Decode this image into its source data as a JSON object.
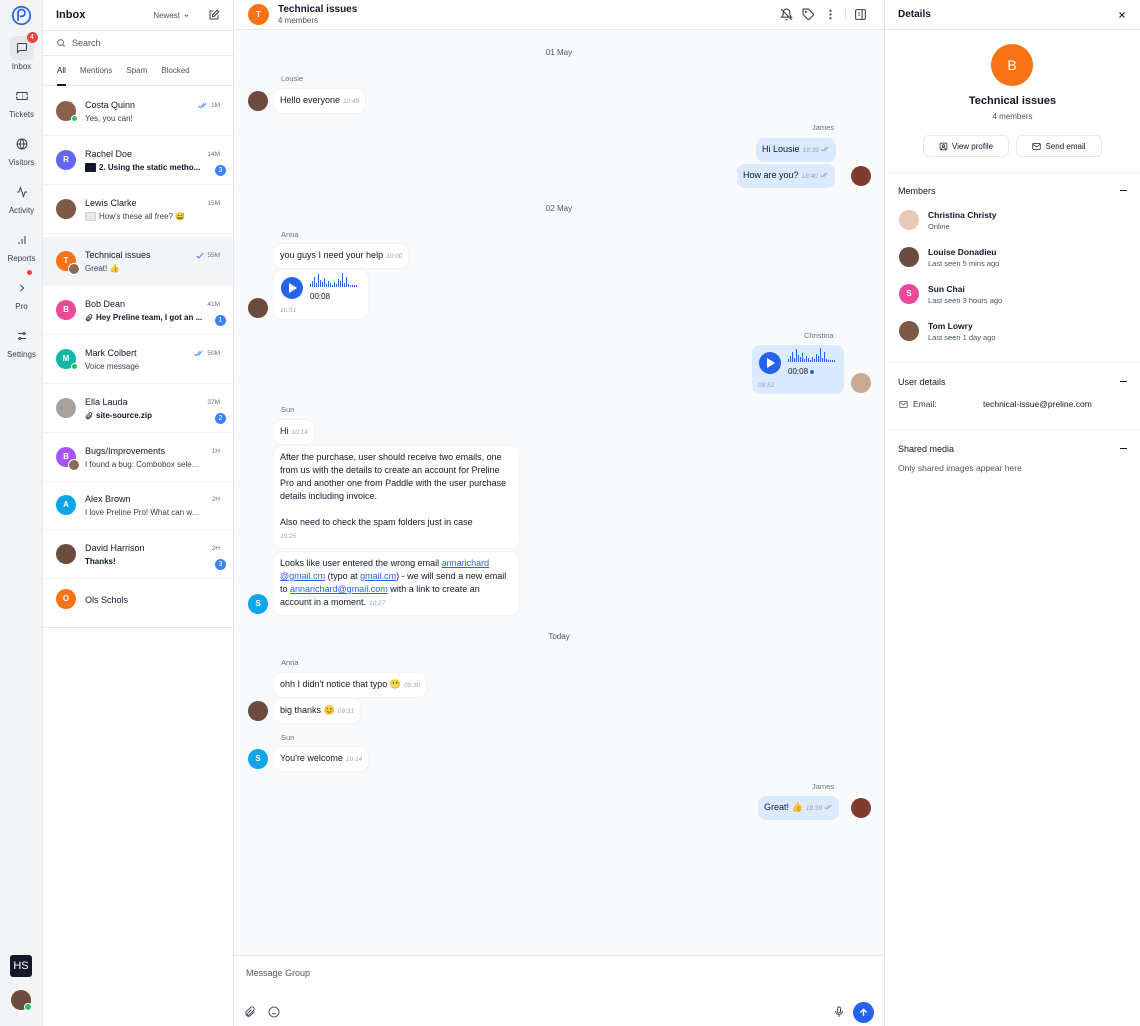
{
  "rail": {
    "inbox_label": "Inbox",
    "inbox_badge": "4",
    "tickets_label": "Tickets",
    "visitors_label": "Visitors",
    "activity_label": "Activity",
    "reports_label": "Reports",
    "pro_label": "Pro",
    "settings_label": "Settings",
    "hs_label": "HS"
  },
  "inbox": {
    "title": "Inbox",
    "sort": "Newest",
    "search_placeholder": "Search",
    "tabs": [
      "All",
      "Mentions",
      "Spam",
      "Blocked"
    ],
    "conversations": [
      {
        "name": "Costa Quinn",
        "preview": "Yes, you can!",
        "time": "1M",
        "read": true
      },
      {
        "name": "Rachel Doe",
        "preview": "2. Using the static metho...",
        "time": "14M",
        "badge": "3",
        "initial": "R"
      },
      {
        "name": "Lewis Clarke",
        "preview": "How's these all free? 😅",
        "time": "15M"
      },
      {
        "name": "Technical issues",
        "preview": "Great! 👍",
        "time": "55M",
        "read": true,
        "initial": "T"
      },
      {
        "name": "Bob Dean",
        "preview": "Hey Preline team, I got an ...",
        "time": "41M",
        "badge": "1",
        "initial": "B"
      },
      {
        "name": "Mark Colbert",
        "preview": "Voice message",
        "time": "50M",
        "read": true,
        "initial": "M"
      },
      {
        "name": "Ella Lauda",
        "preview": "site-source.zip",
        "time": "37M",
        "badge": "2"
      },
      {
        "name": "Bugs/Improvements",
        "preview": "I found a bug: Combobox sele...",
        "time": "1H",
        "initial": "B"
      },
      {
        "name": "Alex Brown",
        "preview": "I love Preline Pro! What can w...",
        "time": "2H",
        "initial": "A"
      },
      {
        "name": "David Harrison",
        "preview": "Thanks!",
        "time": "2H",
        "badge": "3"
      },
      {
        "name": "Ols Schols",
        "preview": "",
        "time": "",
        "initial": "O"
      }
    ]
  },
  "chat": {
    "avatar_initial": "T",
    "title": "Technical issues",
    "subtitle": "4 members",
    "days": [
      "01 May",
      "02 May",
      "Today"
    ],
    "authors": {
      "lousie": "Lousie",
      "james": "James",
      "anna": "Anna",
      "christina": "Christina",
      "sun": "Sun"
    },
    "messages": {
      "m1": {
        "text": "Hello everyone",
        "time": "10:49"
      },
      "m2": {
        "text": "Hi Lousie",
        "time": "18:39"
      },
      "m3": {
        "text": "How are you?",
        "time": "18:40"
      },
      "m4": {
        "text": "you guys I need your help",
        "time": "10:00"
      },
      "m5": {
        "duration": "00:08",
        "time": "10:51"
      },
      "m6": {
        "duration": "00:08",
        "time": "09:52"
      },
      "m7": {
        "text": "Hi",
        "time": "10:14"
      },
      "m8": {
        "p1": "After the purchase, user should receive two emails, one from us with the details to create an account for Preline Pro and another one from Paddle with the user purchase details including invoice.",
        "p2": "Also need to check the spam folders just in case",
        "time": "10:25"
      },
      "m9": {
        "t1": "Looks like user entered the wrong email ",
        "l1a": "annarichard",
        "l1b": "@gmail.cm",
        "t2": " (typo at ",
        "l2": "gmail.cm",
        "t3": ") - we will send a new email to ",
        "l3": "annarichard@gmail.com",
        "t4": " with a link to create an account in a moment.",
        "time": "10:27"
      },
      "m10": {
        "text": "ohh I didn't notice that typo 😬",
        "time": "09:30"
      },
      "m11": {
        "text": "big thanks 😊",
        "time": "09:31"
      },
      "m12": {
        "text": "You're welcome",
        "time": "10:14"
      },
      "m13": {
        "text": "Great! 👍",
        "time": "18:39"
      }
    },
    "sun_initial": "S",
    "composer_placeholder": "Message Group"
  },
  "details": {
    "title": "Details",
    "avatar_initial": "B",
    "name": "Technical issues",
    "members_count": "4 members",
    "view_profile": "View profile",
    "send_email": "Send email",
    "members_title": "Members",
    "members": [
      {
        "name": "Christina Christy",
        "status": "Online"
      },
      {
        "name": "Louise Donadieu",
        "status": "Last seen 5 mins ago"
      },
      {
        "name": "Sun Chai",
        "status": "Last seen 3 hours ago",
        "initial": "S"
      },
      {
        "name": "Tom Lowry",
        "status": "Last seen 1 day ago"
      }
    ],
    "user_details_title": "User details",
    "email_label": "Email:",
    "email_value": "technical-issue@preline.com",
    "shared_media_title": "Shared media",
    "shared_media_empty": "Only shared images appear here"
  },
  "colors": {
    "accent": "#2563eb",
    "orange": "#f97316",
    "badge": "#3b82f6",
    "online": "#22c55e"
  },
  "icons": [
    "preline-logo-icon",
    "chat-icon",
    "ticket-icon",
    "globe-icon",
    "activity-icon",
    "bar-chart-icon",
    "chevron-right-icon",
    "settings-icon",
    "search-icon",
    "compose-icon",
    "bell-off-icon",
    "tag-icon",
    "more-vertical-icon",
    "sidebar-icon",
    "close-icon",
    "paperclip-icon",
    "smile-icon",
    "mic-icon",
    "arrow-up-icon",
    "user-icon",
    "mail-icon",
    "double-check-icon"
  ]
}
